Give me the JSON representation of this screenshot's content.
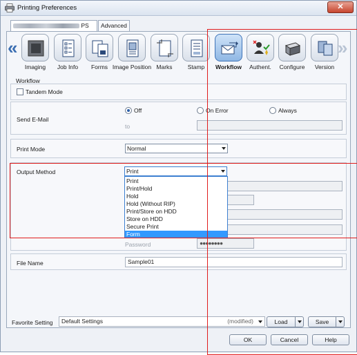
{
  "window": {
    "title": "Printing Preferences",
    "close_glyph": "✕"
  },
  "tabs": [
    {
      "label": "PS"
    },
    {
      "label": "Advanced"
    }
  ],
  "nav": {
    "left_glyph": "«",
    "right_glyph": "»"
  },
  "toolbar": {
    "items": [
      {
        "label": "Imaging",
        "icon": "imaging-icon"
      },
      {
        "label": "Job Info",
        "icon": "job-info-icon"
      },
      {
        "label": "Forms",
        "icon": "forms-icon"
      },
      {
        "label": "Image Position",
        "icon": "image-position-icon"
      },
      {
        "label": "Marks",
        "icon": "marks-icon"
      },
      {
        "label": "Stamp",
        "icon": "stamp-icon"
      },
      {
        "label": "Workflow",
        "icon": "workflow-icon",
        "active": true
      },
      {
        "label": "Authent.",
        "icon": "authentication-icon"
      },
      {
        "label": "Configure",
        "icon": "configure-icon"
      },
      {
        "label": "Version",
        "icon": "version-icon"
      }
    ]
  },
  "workflow": {
    "section_title": "Workflow",
    "tandem_mode": {
      "label": "Tandem Mode",
      "checked": false
    },
    "send_email": {
      "label": "Send E-Mail",
      "options": [
        "Off",
        "On Error",
        "Always"
      ],
      "selected": "Off",
      "to_placeholder": "to",
      "to_value": ""
    },
    "print_mode": {
      "label": "Print Mode",
      "value": "Normal"
    },
    "output_method": {
      "label": "Output Method",
      "value": "Print",
      "options": [
        "Print",
        "Print/Hold",
        "Hold",
        "Hold (Without RIP)",
        "Print/Store on HDD",
        "Store on HDD",
        "Secure Print",
        "Form"
      ],
      "highlighted": "Form",
      "password_label": "Password",
      "password_value": "●●●●●●●●"
    },
    "file_name": {
      "label": "File Name",
      "value": "Sample01"
    }
  },
  "footer": {
    "favorite_label": "Favorite Setting",
    "favorite_value": "Default Settings",
    "modified_label": "(modified)",
    "load_label": "Load",
    "save_label": "Save",
    "ok_label": "OK",
    "cancel_label": "Cancel",
    "help_label": "Help"
  },
  "colors": {
    "highlight": "#e01b1b",
    "selection": "#3399ff",
    "accent": "#3c6fb2"
  }
}
